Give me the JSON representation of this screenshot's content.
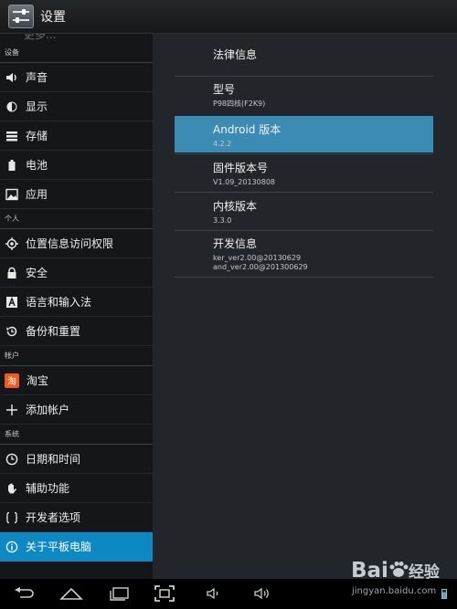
{
  "actionbar": {
    "title": "设置"
  },
  "left": {
    "cut_text": "更多...",
    "sections": {
      "device": "设备",
      "personal": "个人",
      "accounts": "帐户",
      "system": "系统"
    },
    "items": {
      "sound": "声音",
      "display": "显示",
      "storage": "存储",
      "battery": "电池",
      "apps": "应用",
      "location": "位置信息访问权限",
      "security": "安全",
      "language": "语言和输入法",
      "backup": "备份和重置",
      "taobao": "淘宝",
      "add_account": "添加帐户",
      "datetime": "日期和时间",
      "accessibility": "辅助功能",
      "developer": "开发者选项",
      "about": "关于平板电脑"
    },
    "taobao_glyph": "淘"
  },
  "right": {
    "legal": {
      "title": "法律信息"
    },
    "model": {
      "title": "型号",
      "value": "P98四核(F2K9)"
    },
    "android": {
      "title": "Android 版本",
      "value": "4.2.2"
    },
    "firmware": {
      "title": "固件版本号",
      "value": "V1.09_20130808"
    },
    "kernel": {
      "title": "内核版本",
      "value": "3.3.0"
    },
    "dev_info": {
      "title": "开发信息",
      "line1": "ker_ver2.00@20130629",
      "line2": "and_ver2.00@201300629"
    }
  },
  "watermark": {
    "brand": "Bai",
    "brand2": "经验",
    "url": "jingyan.baidu.com"
  },
  "colors": {
    "accent": "#0d88c2",
    "highlight": "#3b8bb4"
  }
}
